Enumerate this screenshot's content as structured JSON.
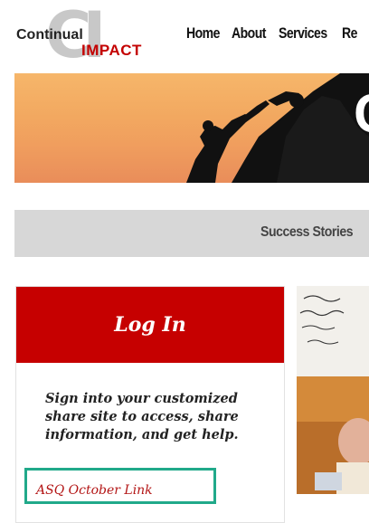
{
  "brand": {
    "logo_ci": "CI",
    "logo_continual": "Continual",
    "logo_impact": "IMPACT"
  },
  "nav": {
    "items": [
      "Home",
      "About",
      "Services",
      "Re"
    ]
  },
  "hero": {
    "partial_heading_letter": "C"
  },
  "strip": {
    "title": "Success Stories"
  },
  "login": {
    "heading": "Log In",
    "description": "Sign into your customized share site to access, share information, and get help.",
    "link": "ASQ October Link"
  },
  "colors": {
    "accent_red": "#c60000",
    "highlight_green": "#21a98a",
    "strip_gray": "#d7d7d7"
  }
}
